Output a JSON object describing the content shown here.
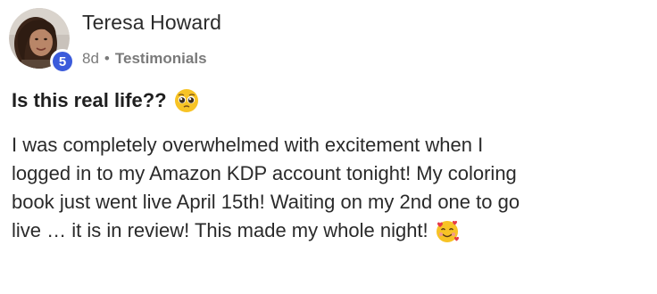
{
  "post": {
    "author": {
      "name": "Teresa Howard",
      "level": "5",
      "avatar_icon": "avatar-photo"
    },
    "meta": {
      "time": "8d",
      "separator": "•",
      "category": "Testimonials"
    },
    "title": "Is this real life??",
    "title_emoji": "pleading-face-icon",
    "body_lines": [
      "I was completely overwhelmed with excitement when I",
      "logged in to my Amazon KDP account tonight! My coloring",
      "book just went live April 15th! Waiting on my 2nd one to go",
      "live … it is in review! This made my whole night!"
    ],
    "body_end_emoji": "smiling-face-with-hearts-icon"
  },
  "colors": {
    "badge": "#3b5bdb",
    "meta_text": "#7a7a7a",
    "emoji_yellow": "#f7c325"
  }
}
